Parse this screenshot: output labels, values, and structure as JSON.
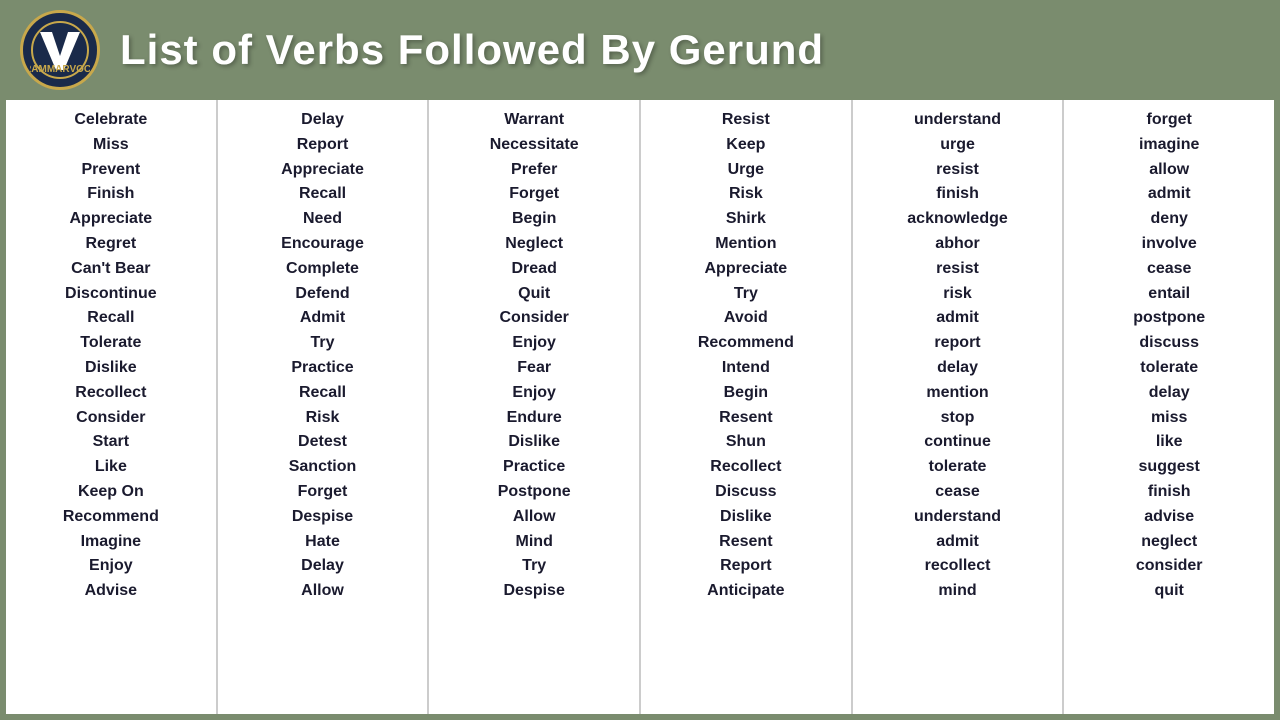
{
  "header": {
    "title": "List of Verbs Followed By Gerund"
  },
  "columns": [
    {
      "id": "col1",
      "words": [
        "Celebrate",
        "Miss",
        "Prevent",
        "Finish",
        "Appreciate",
        "Regret",
        "Can't Bear",
        "Discontinue",
        "Recall",
        "Tolerate",
        "Dislike",
        "Recollect",
        "Consider",
        "Start",
        "Like",
        "Keep On",
        "Recommend",
        "Imagine",
        "Enjoy",
        "Advise"
      ]
    },
    {
      "id": "col2",
      "words": [
        "Delay",
        "Report",
        "Appreciate",
        "Recall",
        "Need",
        "Encourage",
        "Complete",
        "Defend",
        "Admit",
        "Try",
        "Practice",
        "Recall",
        "Risk",
        "Detest",
        "Sanction",
        "Forget",
        "Despise",
        "Hate",
        "Delay",
        "Allow"
      ]
    },
    {
      "id": "col3",
      "words": [
        "Warrant",
        "Necessitate",
        "Prefer",
        "Forget",
        "Begin",
        "Neglect",
        "Dread",
        "Quit",
        "Consider",
        "Enjoy",
        "Fear",
        "Enjoy",
        "Endure",
        "Dislike",
        "Practice",
        "Postpone",
        "Allow",
        "Mind",
        "Try",
        "Despise"
      ]
    },
    {
      "id": "col4",
      "words": [
        "Resist",
        "Keep",
        "Urge",
        "Risk",
        "Shirk",
        "Mention",
        "Appreciate",
        "Try",
        "Avoid",
        "Recommend",
        "Intend",
        "Begin",
        "Resent",
        "Shun",
        "Recollect",
        "Discuss",
        "Dislike",
        "Resent",
        "Report",
        "Anticipate"
      ]
    },
    {
      "id": "col5",
      "words": [
        "understand",
        "urge",
        "resist",
        "finish",
        "acknowledge",
        "abhor",
        "resist",
        "risk",
        "admit",
        "report",
        "delay",
        "mention",
        "stop",
        "continue",
        "tolerate",
        "cease",
        "understand",
        "admit",
        "recollect",
        "mind"
      ]
    },
    {
      "id": "col6",
      "words": [
        "forget",
        "imagine",
        "allow",
        "admit",
        "deny",
        "involve",
        "cease",
        "entail",
        "postpone",
        "discuss",
        "tolerate",
        "delay",
        "miss",
        "like",
        "suggest",
        "finish",
        "advise",
        "neglect",
        "consider",
        "quit"
      ]
    }
  ]
}
